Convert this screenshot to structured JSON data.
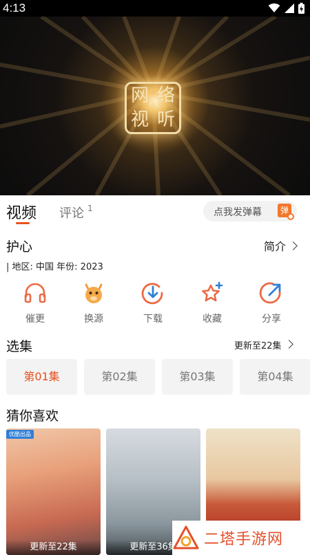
{
  "status_bar": {
    "time": "4:13",
    "icons": [
      "wifi-icon",
      "signal-icon",
      "battery-charging-icon"
    ]
  },
  "player": {
    "logo_chars": [
      "网",
      "络",
      "视",
      "听"
    ]
  },
  "tabs": {
    "video": "视频",
    "comments": "评论",
    "comment_count": "1",
    "danmaku_placeholder": "点我发弹幕",
    "danmaku_icon": "弹"
  },
  "show": {
    "title": "护心",
    "intro_label": "简介",
    "meta": "|  地区: 中国    年份: 2023"
  },
  "actions": [
    {
      "label": "催更",
      "icon": "headphones-icon"
    },
    {
      "label": "换源",
      "icon": "camel-icon"
    },
    {
      "label": "下载",
      "icon": "download-icon"
    },
    {
      "label": "收藏",
      "icon": "star-add-icon"
    },
    {
      "label": "分享",
      "icon": "share-icon"
    }
  ],
  "episodes": {
    "section_title": "选集",
    "update_status": "更新至22集",
    "items": [
      "第01集",
      "第02集",
      "第03集",
      "第04集"
    ],
    "selected": "第01集"
  },
  "recommend": {
    "section_title": "猜你喜欢",
    "items": [
      {
        "update": "更新至22集",
        "badge": "优酷出品"
      },
      {
        "update": "更新至36集"
      },
      {
        "update": ""
      }
    ]
  },
  "watermark": {
    "text": "二塔手游网"
  },
  "colors": {
    "accent": "#e8521f",
    "chip_bg": "#f3f3f3"
  }
}
